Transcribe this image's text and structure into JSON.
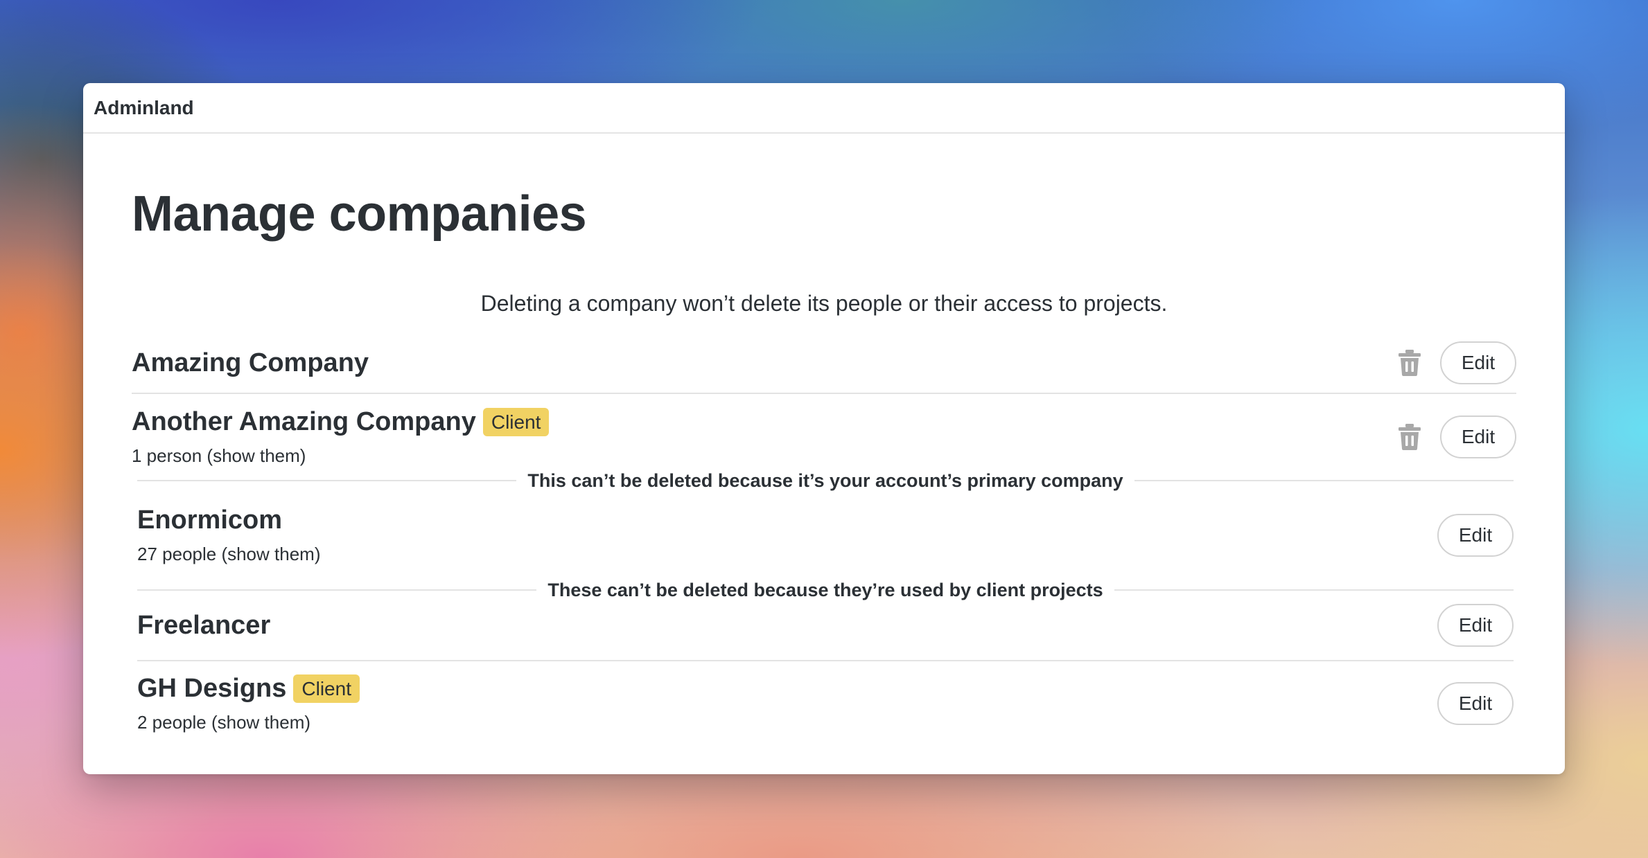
{
  "header": {
    "brand": "Adminland"
  },
  "page": {
    "title": "Manage companies",
    "notice": "Deleting a company won’t delete its people or their access to projects."
  },
  "labels": {
    "edit": "Edit",
    "client_badge": "Client"
  },
  "companies_deletable": [
    {
      "name": "Amazing Company",
      "badge": "",
      "people": ""
    },
    {
      "name": "Another Amazing Company",
      "badge": "Client",
      "people": "1 person (show them)"
    }
  ],
  "primary_section": {
    "heading": "This can’t be deleted because it’s your account’s primary company",
    "company": {
      "name": "Enormicom",
      "people": "27 people (show them)"
    }
  },
  "client_projects_section": {
    "heading": "These can’t be deleted because they’re used by client projects",
    "companies": [
      {
        "name": "Freelancer",
        "badge": "",
        "people": ""
      },
      {
        "name": "GH Designs",
        "badge": "Client",
        "people": "2 people (show them)"
      }
    ]
  },
  "icons": {
    "trash": "trash-icon",
    "trash_color": "#a8a8a8"
  },
  "colors": {
    "badge": "#f1d263",
    "text": "#2b3035",
    "border": "#e3e3e3"
  }
}
